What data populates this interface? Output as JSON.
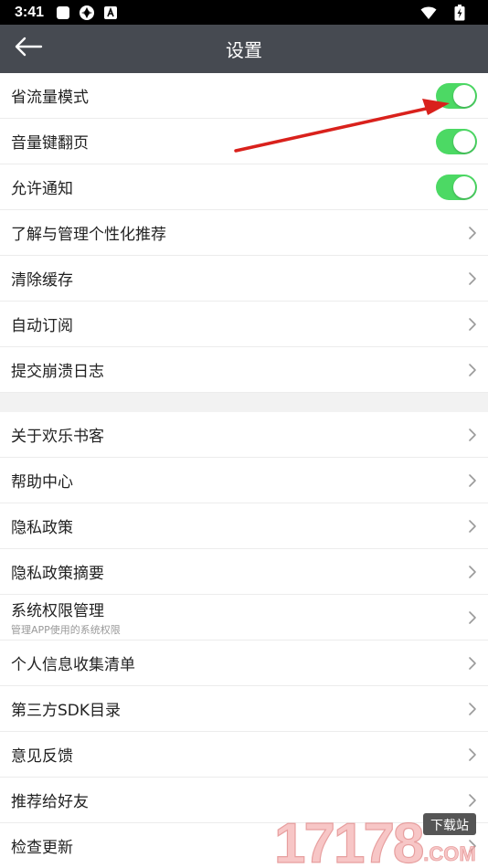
{
  "status_bar": {
    "time": "3:41",
    "icons": [
      "square-icon",
      "aperture-icon",
      "a-icon"
    ],
    "right_icons": [
      "wifi-icon",
      "battery-icon"
    ]
  },
  "header": {
    "title": "设置",
    "back_icon": "arrow-left-icon"
  },
  "groups": [
    {
      "items": [
        {
          "label": "省流量模式",
          "type": "toggle",
          "on": true
        },
        {
          "label": "音量键翻页",
          "type": "toggle",
          "on": true
        },
        {
          "label": "允许通知",
          "type": "toggle",
          "on": true
        },
        {
          "label": "了解与管理个性化推荐",
          "type": "link"
        },
        {
          "label": "清除缓存",
          "type": "link"
        },
        {
          "label": "自动订阅",
          "type": "link"
        },
        {
          "label": "提交崩溃日志",
          "type": "link"
        }
      ]
    },
    {
      "items": [
        {
          "label": "关于欢乐书客",
          "type": "link"
        },
        {
          "label": "帮助中心",
          "type": "link"
        },
        {
          "label": "隐私政策",
          "type": "link"
        },
        {
          "label": "隐私政策摘要",
          "type": "link"
        },
        {
          "label": "系统权限管理",
          "sub": "管理APP使用的系统权限",
          "type": "link"
        },
        {
          "label": "个人信息收集清单",
          "type": "link"
        },
        {
          "label": "第三方SDK目录",
          "type": "link"
        },
        {
          "label": "意见反馈",
          "type": "link"
        },
        {
          "label": "推荐给好友",
          "type": "link"
        },
        {
          "label": "检查更新",
          "type": "link"
        }
      ]
    }
  ],
  "watermark": {
    "number": "17178",
    "badge": "下载站",
    "domain": ".COM"
  },
  "colors": {
    "title_bar": "#464a51",
    "toggle_on": "#4cd964",
    "annotation_arrow": "#d9211c",
    "watermark": "#f2a0a0"
  }
}
